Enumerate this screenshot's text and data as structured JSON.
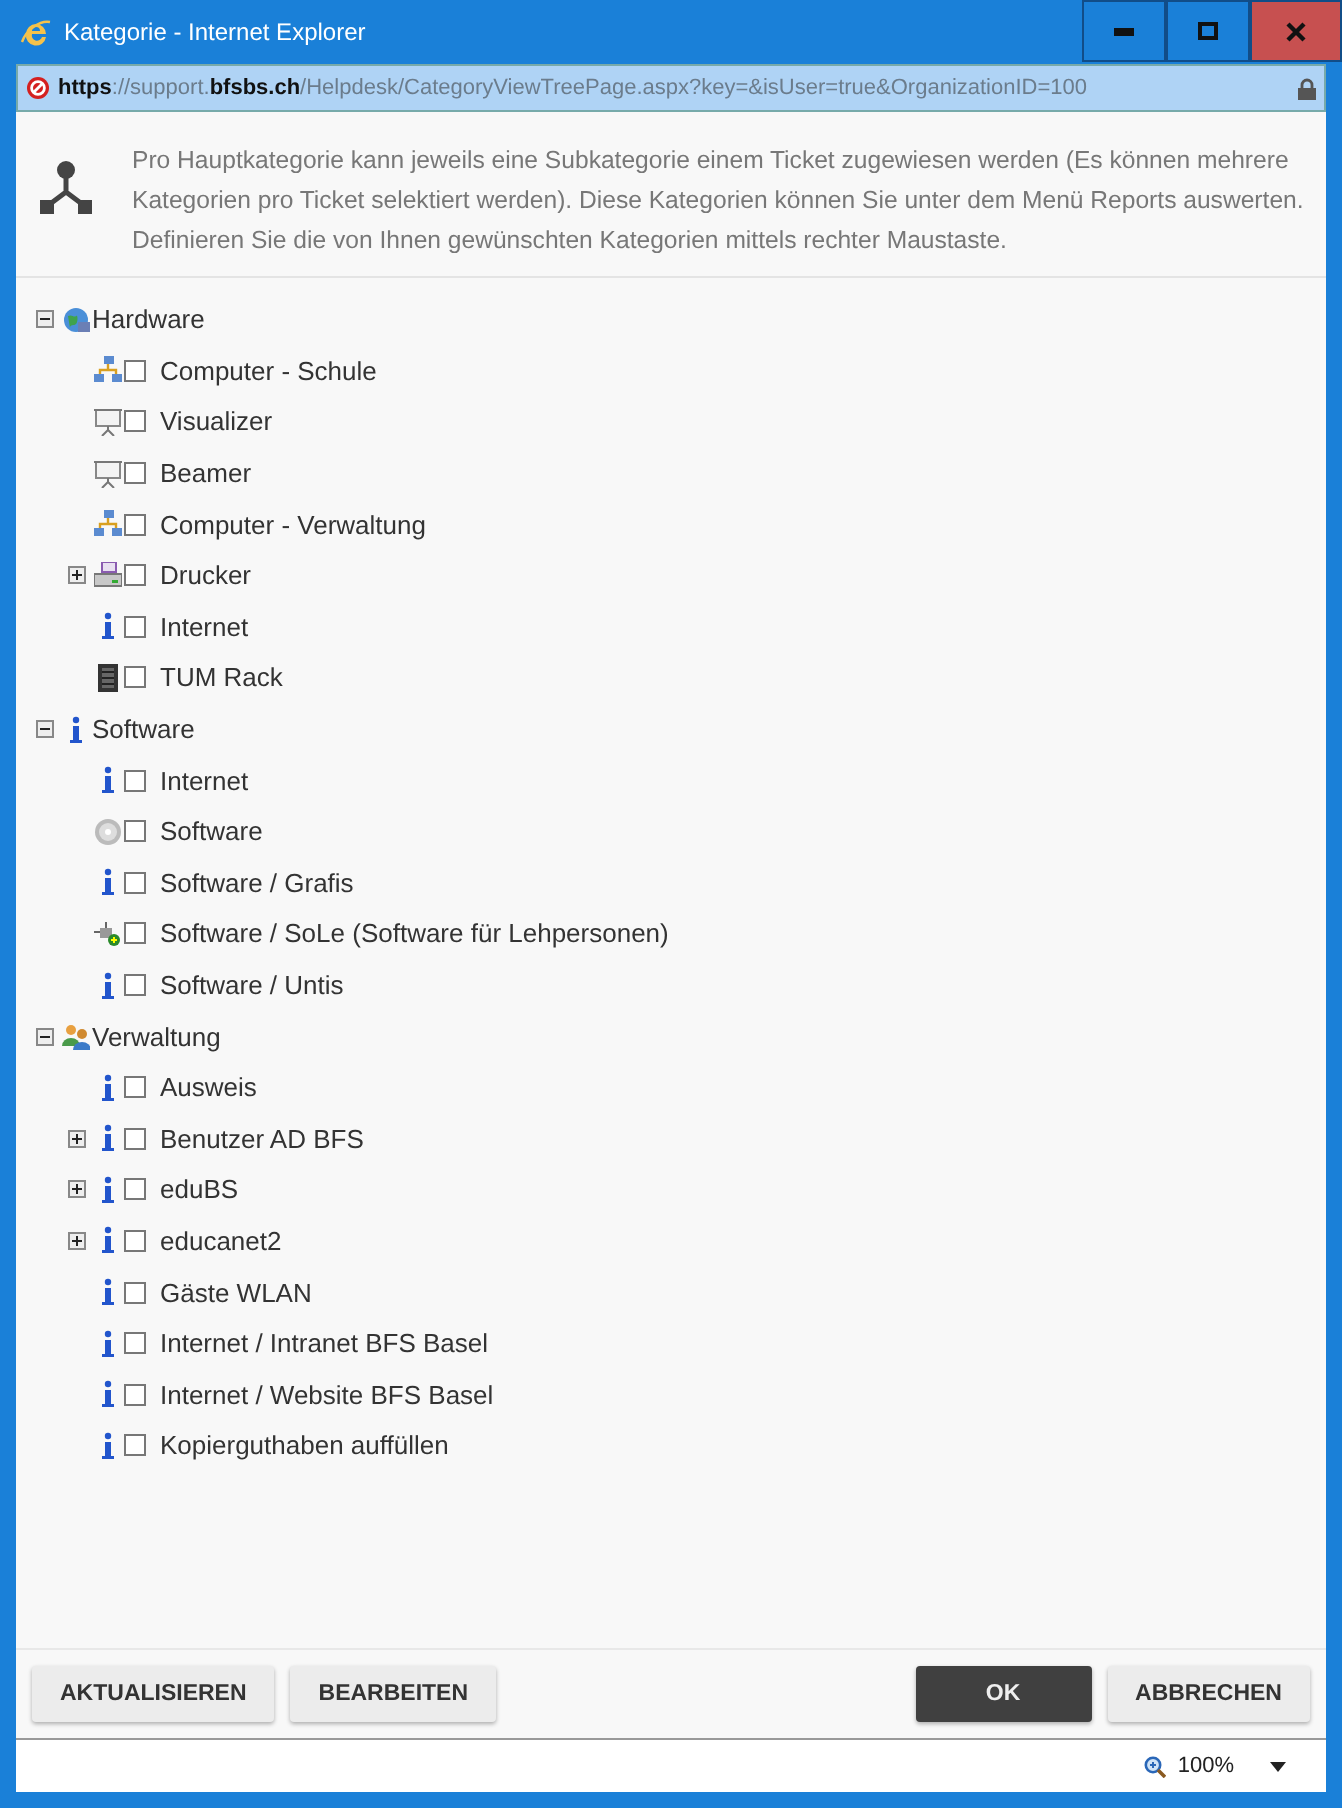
{
  "window": {
    "title": "Kategorie - Internet Explorer",
    "controls": [
      {
        "kind": "minimize"
      },
      {
        "kind": "maximize"
      },
      {
        "kind": "close"
      }
    ]
  },
  "address_bar": {
    "url": "**https**://support.**bfsbs.ch**/Helpdesk/CategoryViewTreePage.aspx?key=&isUser=true&OrganizationID=100"
  },
  "info": {
    "text": "Pro Hauptkategorie kann jeweils eine Subkategorie einem Ticket zugewiesen werden (Es können mehrere Kategorien pro Ticket selektiert werden). Diese Kategorien können Sie unter dem Menü Reports auswerten. Definieren Sie die von Ihnen gewünschten Kategorien mittels rechter Maustaste."
  },
  "tree": [
    {
      "label": "Hardware",
      "kind": "globe",
      "expanded": true,
      "children": [
        {
          "label": "Computer - Schule",
          "kind": "network",
          "checked": false
        },
        {
          "label": "Visualizer",
          "kind": "projector",
          "checked": false
        },
        {
          "label": "Beamer",
          "kind": "projector",
          "checked": false
        },
        {
          "label": "Computer - Verwaltung",
          "kind": "network",
          "checked": false
        },
        {
          "label": "Drucker",
          "kind": "printer",
          "checked": false,
          "expanded": false
        },
        {
          "label": "Internet",
          "kind": "info",
          "checked": false
        },
        {
          "label": "TUM Rack",
          "kind": "rack",
          "checked": false
        }
      ]
    },
    {
      "label": "Software",
      "kind": "info",
      "expanded": true,
      "children": [
        {
          "label": "Internet",
          "kind": "info",
          "checked": false
        },
        {
          "label": "Software",
          "kind": "disc",
          "checked": false
        },
        {
          "label": "Software / Grafis",
          "kind": "info",
          "checked": false
        },
        {
          "label": "Software / SoLe (Software für Lehpersonen)",
          "kind": "plugin",
          "checked": false
        },
        {
          "label": "Software / Untis",
          "kind": "info",
          "checked": false
        }
      ]
    },
    {
      "label": "Verwaltung",
      "kind": "users",
      "expanded": true,
      "children": [
        {
          "label": "Ausweis",
          "kind": "info",
          "checked": false
        },
        {
          "label": "Benutzer AD BFS",
          "kind": "info",
          "checked": false,
          "expanded": false
        },
        {
          "label": "eduBS",
          "kind": "info",
          "checked": false,
          "expanded": false
        },
        {
          "label": "educanet2",
          "kind": "info",
          "checked": false,
          "expanded": false
        },
        {
          "label": "Gäste WLAN",
          "kind": "info",
          "checked": false
        },
        {
          "label": "Internet / Intranet BFS Basel",
          "kind": "info",
          "checked": false
        },
        {
          "label": "Internet / Website BFS Basel",
          "kind": "info",
          "checked": false
        },
        {
          "label": "Kopierguthaben auffüllen",
          "kind": "info",
          "checked": false
        }
      ]
    }
  ],
  "buttons_left": [
    "AKTUALISIEREN",
    "BEARBEITEN"
  ],
  "buttons_right": [
    {
      "label": "OK",
      "primary": true
    },
    {
      "label": "ABBRECHEN",
      "primary": false
    }
  ],
  "status_bar": {
    "zoom": "100%"
  }
}
